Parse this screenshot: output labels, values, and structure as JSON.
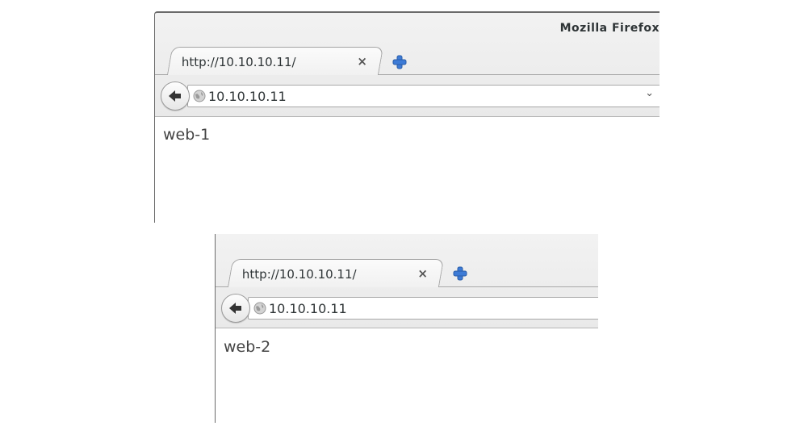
{
  "windows": [
    {
      "title": "Mozilla Firefox",
      "tab": {
        "label": "http://10.10.10.11/",
        "close": "×"
      },
      "url": "10.10.10.11",
      "url_dropdown": "⌄",
      "content": "web-1"
    },
    {
      "tab": {
        "label": "http://10.10.10.11/",
        "close": "×"
      },
      "url": "10.10.10.11",
      "content": "web-2"
    }
  ],
  "colors": {
    "new_tab_plus": "#3d7bd6",
    "chrome_bg": "#ececec"
  },
  "icons": [
    "back-arrow-icon",
    "globe-icon",
    "new-tab-plus-icon",
    "close-icon",
    "chevron-down-icon"
  ]
}
